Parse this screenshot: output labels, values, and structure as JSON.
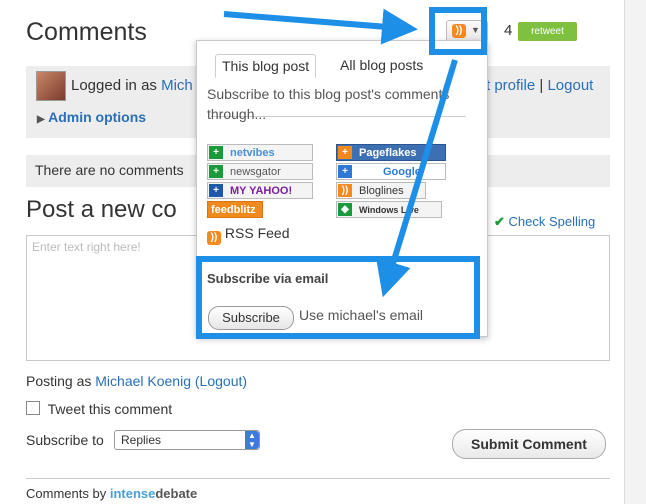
{
  "header": {
    "title": "Comments",
    "comment_count": "4",
    "retweet_label": "retweet"
  },
  "login": {
    "prefix": "Logged in as",
    "user_cut": "Mich",
    "edit_profile": "t profile",
    "separator": "|",
    "logout": "Logout",
    "admin": "Admin options"
  },
  "no_comments": "There are no comments",
  "post_new": "Post a new co",
  "spell_check": "Check Spelling",
  "textarea_placeholder": "Enter text right here!",
  "posting_as": {
    "prefix": "Posting as",
    "name": "Michael Koenig",
    "logout": "(Logout)"
  },
  "tweet_comment": "Tweet this comment",
  "subscribe": {
    "label": "Subscribe to",
    "selected": "Replies"
  },
  "submit_label": "Submit Comment",
  "footer": {
    "prefix": "Comments by",
    "brand_a": "intense",
    "brand_b": "debate"
  },
  "popup": {
    "tabs": [
      "This blog post",
      "All blog posts"
    ],
    "description": "Subscribe to this blog post's comments through...",
    "services": [
      {
        "name": "netvibes",
        "color": "#1b9a3b"
      },
      {
        "name": "newsgator",
        "color": "#1b9a3b"
      },
      {
        "name": "MY YAHOO!",
        "color": "#2058a8"
      },
      {
        "name": "feedblitz",
        "color": "#f08a1c"
      },
      {
        "name": "Pageflakes",
        "color": "#f08a1c"
      },
      {
        "name": "Google",
        "color": "#2d7ad5"
      },
      {
        "name": "Bloglines",
        "color": "#f48a20"
      },
      {
        "name": "Windows Live",
        "color": "#1b9a3b"
      }
    ],
    "rss_feed": "RSS Feed",
    "email_heading": "Subscribe via email",
    "email_button": "Subscribe",
    "email_note": "Use michael's email"
  },
  "colors": {
    "highlight": "#1e8fe6",
    "link": "#2a6fb7",
    "retweet": "#7fc041"
  }
}
